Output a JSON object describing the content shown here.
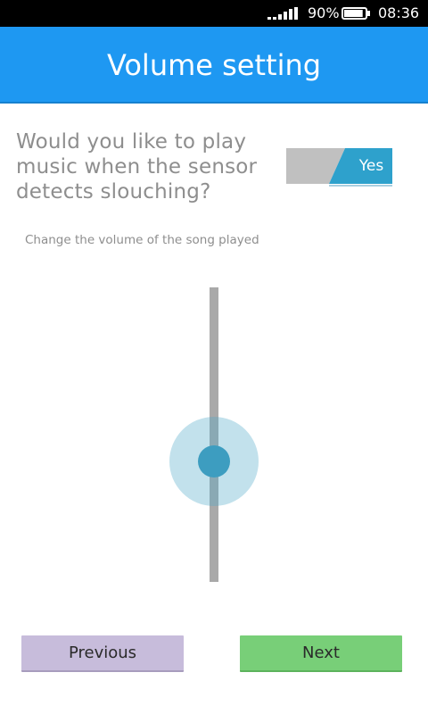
{
  "status_bar": {
    "signal_icon": "signal-bars-icon",
    "battery_percent": "90%",
    "battery_icon": "battery-icon",
    "battery_level": 0.9,
    "time": "08:36"
  },
  "header": {
    "title": "Volume setting",
    "color": "#1e98f2"
  },
  "question": {
    "text": "Would you like to play music when the sensor detects slouching?"
  },
  "toggle": {
    "label": "Yes",
    "state": true,
    "on_color": "#2ea1cc",
    "off_color": "#c0c0c0"
  },
  "volume": {
    "label": "Change the volume of the song played",
    "level": 0.41,
    "thumb_color": "#3d9dc0"
  },
  "buttons": {
    "previous_label": "Previous",
    "next_label": "Next",
    "previous_color": "#c7bcdb",
    "next_color": "#78cf78"
  }
}
